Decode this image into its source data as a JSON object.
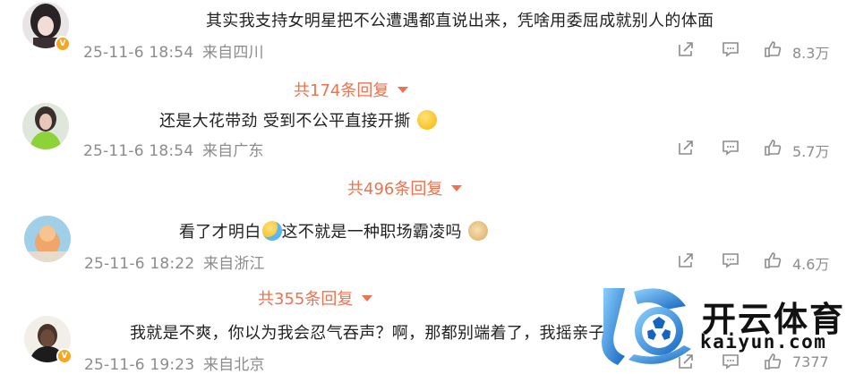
{
  "comments": [
    {
      "text": "其实我支持女明星把不公遭遇都直说出来，凭啥用委屈成就别人的体面",
      "time": "25-11-6 18:54",
      "location": "来自四川",
      "likes": "8.3万",
      "verified": true,
      "replies_label": "共174条回复"
    },
    {
      "text": "还是大花带劲 受到不公平直接开撕",
      "time": "25-11-6 18:54",
      "location": "来自广东",
      "likes": "5.7万",
      "verified": false,
      "replies_label": "共496条回复"
    },
    {
      "text_before": "看了才明白",
      "text_after": "这不就是一种职场霸凌吗",
      "time": "25-11-6 18:22",
      "location": "来自浙江",
      "likes": "4.6万",
      "verified": false,
      "replies_label": "共355条回复"
    },
    {
      "text": "我就是不爽，你以为我会忍气吞声？啊，那都别端着了，我摇亲子",
      "time": "25-11-6 19:23",
      "location": "来自北京",
      "likes": "7377",
      "verified": true
    }
  ],
  "icons": {
    "share": "share-icon",
    "comment": "comment-icon",
    "like": "like-icon",
    "reply_toggle": "chevron-down-icon"
  },
  "colors": {
    "reply_link": "#eb7350",
    "meta_gray": "#8c8c8c",
    "verified_badge": "#f5a623",
    "watermark_blue": "#1e88e5"
  },
  "watermark": {
    "brand_cn": "开云体育",
    "brand_en": "kaiyun.com"
  }
}
